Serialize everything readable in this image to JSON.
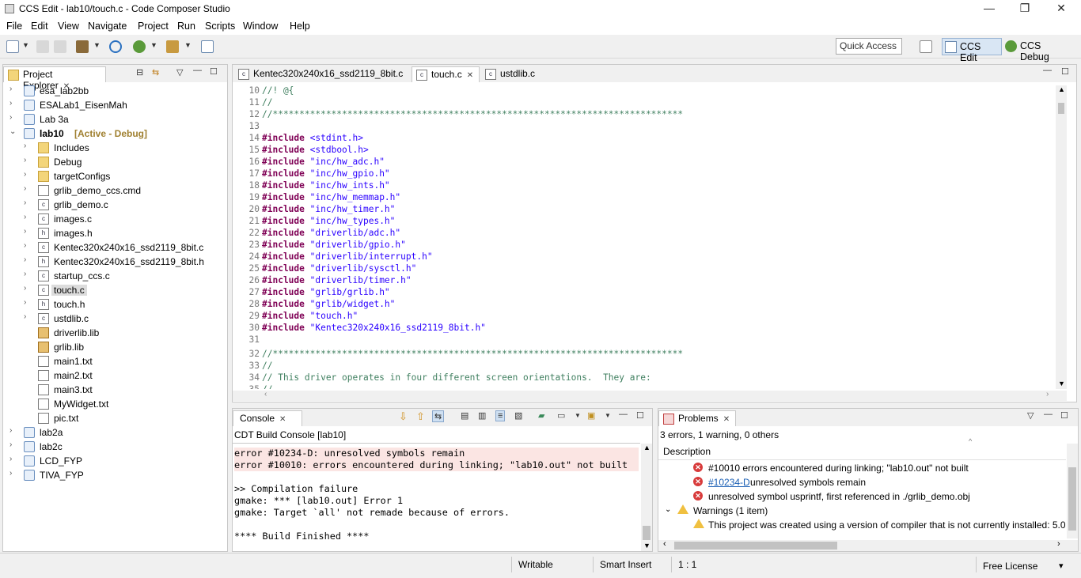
{
  "window": {
    "title": "CCS Edit - lab10/touch.c - Code Composer Studio",
    "minimize": "—",
    "restore": "❐",
    "close": "✕"
  },
  "menu": [
    "File",
    "Edit",
    "View",
    "Navigate",
    "Project",
    "Run",
    "Scripts",
    "Window",
    "Help"
  ],
  "toolbar": {
    "quick_access_placeholder": "Quick Access",
    "perspective_edit": "CCS Edit",
    "perspective_debug": "CCS Debug"
  },
  "project_explorer": {
    "title": "Project Explorer",
    "items": [
      {
        "label": "esa_lab2bb",
        "kind": "project",
        "depth": 0,
        "expanded": false
      },
      {
        "label": "ESALab1_EisenMah",
        "kind": "project",
        "depth": 0,
        "expanded": false
      },
      {
        "label": "Lab 3a",
        "kind": "project",
        "depth": 0,
        "expanded": false
      },
      {
        "label": "lab10",
        "kind": "project",
        "depth": 0,
        "expanded": true,
        "suffix": "[Active - Debug]"
      },
      {
        "label": "Includes",
        "kind": "includes",
        "depth": 1,
        "expanded": false
      },
      {
        "label": "Debug",
        "kind": "folder",
        "depth": 1,
        "expanded": false
      },
      {
        "label": "targetConfigs",
        "kind": "folder",
        "depth": 1,
        "expanded": false
      },
      {
        "label": "grlib_demo_ccs.cmd",
        "kind": "cmd",
        "depth": 1,
        "expanded": false
      },
      {
        "label": "grlib_demo.c",
        "kind": "c",
        "depth": 1,
        "expanded": false
      },
      {
        "label": "images.c",
        "kind": "c",
        "depth": 1,
        "expanded": false
      },
      {
        "label": "images.h",
        "kind": "h",
        "depth": 1,
        "expanded": false
      },
      {
        "label": "Kentec320x240x16_ssd2119_8bit.c",
        "kind": "c",
        "depth": 1,
        "expanded": false
      },
      {
        "label": "Kentec320x240x16_ssd2119_8bit.h",
        "kind": "h",
        "depth": 1,
        "expanded": false
      },
      {
        "label": "startup_ccs.c",
        "kind": "c",
        "depth": 1,
        "expanded": false
      },
      {
        "label": "touch.c",
        "kind": "c",
        "depth": 1,
        "expanded": false,
        "selected": true
      },
      {
        "label": "touch.h",
        "kind": "h",
        "depth": 1,
        "expanded": false
      },
      {
        "label": "ustdlib.c",
        "kind": "c",
        "depth": 1,
        "expanded": false
      },
      {
        "label": "driverlib.lib",
        "kind": "lib",
        "depth": 1,
        "leaf": true
      },
      {
        "label": "grlib.lib",
        "kind": "lib",
        "depth": 1,
        "leaf": true
      },
      {
        "label": "main1.txt",
        "kind": "txt",
        "depth": 1,
        "leaf": true
      },
      {
        "label": "main2.txt",
        "kind": "txt",
        "depth": 1,
        "leaf": true
      },
      {
        "label": "main3.txt",
        "kind": "txt",
        "depth": 1,
        "leaf": true
      },
      {
        "label": "MyWidget.txt",
        "kind": "txt",
        "depth": 1,
        "leaf": true
      },
      {
        "label": "pic.txt",
        "kind": "txt",
        "depth": 1,
        "leaf": true
      },
      {
        "label": "lab2a",
        "kind": "project",
        "depth": 0,
        "expanded": false
      },
      {
        "label": "lab2c",
        "kind": "project",
        "depth": 0,
        "expanded": false
      },
      {
        "label": "LCD_FYP",
        "kind": "project",
        "depth": 0,
        "expanded": false
      },
      {
        "label": "TIVA_FYP",
        "kind": "project",
        "depth": 0,
        "expanded": false
      }
    ]
  },
  "editor": {
    "tabs": [
      {
        "label": "Kentec320x240x16_ssd2119_8bit.c",
        "active": false
      },
      {
        "label": "touch.c",
        "active": true
      },
      {
        "label": "ustdlib.c",
        "active": false
      }
    ],
    "lines": [
      {
        "n": "10",
        "type": "comment",
        "text": "//! @{"
      },
      {
        "n": "11",
        "type": "comment",
        "text": "//"
      },
      {
        "n": "12",
        "type": "comment",
        "text": "//*****************************************************************************"
      },
      {
        "n": "13",
        "type": "blank",
        "text": ""
      },
      {
        "n": "14",
        "type": "include",
        "target": "<stdint.h>",
        "angle": true
      },
      {
        "n": "15",
        "type": "include",
        "target": "<stdbool.h>",
        "angle": true
      },
      {
        "n": "16",
        "type": "include",
        "target": "\"inc/hw_adc.h\""
      },
      {
        "n": "17",
        "type": "include",
        "target": "\"inc/hw_gpio.h\""
      },
      {
        "n": "18",
        "type": "include",
        "target": "\"inc/hw_ints.h\""
      },
      {
        "n": "19",
        "type": "include",
        "target": "\"inc/hw_memmap.h\""
      },
      {
        "n": "20",
        "type": "include",
        "target": "\"inc/hw_timer.h\""
      },
      {
        "n": "21",
        "type": "include",
        "target": "\"inc/hw_types.h\""
      },
      {
        "n": "22",
        "type": "include",
        "target": "\"driverlib/adc.h\""
      },
      {
        "n": "23",
        "type": "include",
        "target": "\"driverlib/gpio.h\""
      },
      {
        "n": "24",
        "type": "include",
        "target": "\"driverlib/interrupt.h\""
      },
      {
        "n": "25",
        "type": "include",
        "target": "\"driverlib/sysctl.h\""
      },
      {
        "n": "26",
        "type": "include",
        "target": "\"driverlib/timer.h\""
      },
      {
        "n": "27",
        "type": "include",
        "target": "\"grlib/grlib.h\""
      },
      {
        "n": "28",
        "type": "include",
        "target": "\"grlib/widget.h\""
      },
      {
        "n": "29",
        "type": "include",
        "target": "\"touch.h\""
      },
      {
        "n": "30",
        "type": "include",
        "target": "\"Kentec320x240x16_ssd2119_8bit.h\""
      },
      {
        "n": "31",
        "type": "blank",
        "text": ""
      },
      {
        "n": "32",
        "type": "comment",
        "text": "//*****************************************************************************"
      },
      {
        "n": "33",
        "type": "comment",
        "text": "//"
      },
      {
        "n": "34",
        "type": "comment",
        "text": "// This driver operates in four different screen orientations.  They are:"
      },
      {
        "n": "35",
        "type": "comment",
        "text": "//"
      }
    ],
    "include_keyword": "#include"
  },
  "console": {
    "title": "Console",
    "subtitle": "CDT Build Console [lab10]",
    "lines": [
      {
        "text": "error #10234-D: unresolved symbols remain",
        "error": true
      },
      {
        "text": "error #10010: errors encountered during linking; \"lab10.out\" not built",
        "error": true
      },
      {
        "text": "",
        "error": false
      },
      {
        "text": ">> Compilation failure",
        "error": false
      },
      {
        "text": "gmake: *** [lab10.out] Error 1",
        "error": false
      },
      {
        "text": "gmake: Target `all' not remade because of errors.",
        "error": false
      },
      {
        "text": "",
        "error": false
      },
      {
        "text": "**** Build Finished ****",
        "error": false
      }
    ]
  },
  "problems": {
    "title": "Problems",
    "summary": "3 errors, 1 warning, 0 others",
    "column": "Description",
    "errors": [
      {
        "link": "",
        "text": "#10010 errors encountered during linking; \"lab10.out\" not built"
      },
      {
        "link": "#10234-D",
        "text": " unresolved symbols remain"
      },
      {
        "link": "",
        "text": "unresolved symbol usprintf, first referenced in ./grlib_demo.obj"
      }
    ],
    "warnings_group": "Warnings (1 item)",
    "warning": "This project was created using a version of compiler that is not currently installed: 5.0."
  },
  "status": {
    "writable": "Writable",
    "insert_mode": "Smart Insert",
    "position": "1 : 1",
    "license": "Free License"
  }
}
